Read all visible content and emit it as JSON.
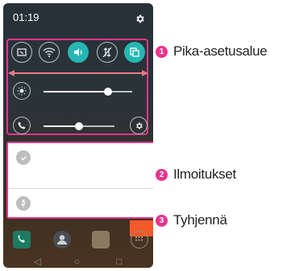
{
  "status_bar": {
    "time": "01:19",
    "settings_icon": "gear-icon"
  },
  "quick_settings": {
    "toggles": [
      {
        "name": "screen-capture-icon",
        "active": false
      },
      {
        "name": "wifi-icon",
        "active": false
      },
      {
        "name": "sound-icon",
        "active": true
      },
      {
        "name": "data-off-icon",
        "active": false
      },
      {
        "name": "copy-icon",
        "active": true
      }
    ],
    "brightness_level": 0.73,
    "volume_level": 0.5,
    "accent_color": "#26b6b3"
  },
  "callouts": [
    {
      "number": "1",
      "label": "Pika-asetusalue"
    },
    {
      "number": "2",
      "label": "Ilmoitukset"
    },
    {
      "number": "3",
      "label": "Tyhjennä"
    }
  ],
  "highlight_color": "#e7348d",
  "clear_button_color": "#f25a2a"
}
